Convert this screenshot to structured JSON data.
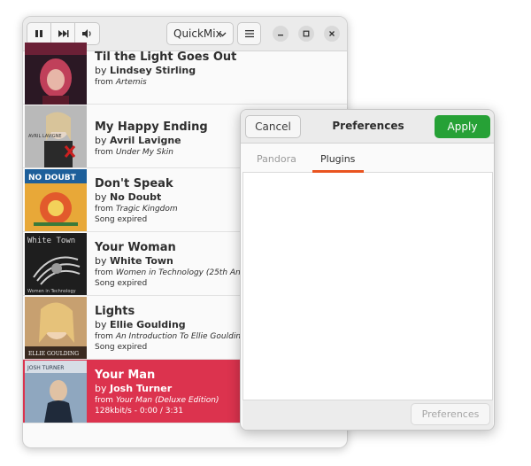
{
  "toolbar": {
    "play_pause_icon": "pause-icon",
    "next_icon": "skip-next-icon",
    "volume_icon": "volume-icon",
    "station_label": "QuickMix",
    "menu_icon": "hamburger-menu-icon"
  },
  "window_controls": [
    "minimize-icon",
    "maximize-icon",
    "close-icon"
  ],
  "songs": [
    {
      "title": "Til the Light Goes Out",
      "by_prefix": "by ",
      "artist": "Lindsey Stirling",
      "from_prefix": "from ",
      "album": "Artemis",
      "status": ""
    },
    {
      "title": "My Happy Ending",
      "by_prefix": "by ",
      "artist": "Avril Lavigne",
      "from_prefix": "from ",
      "album": "Under My Skin",
      "status": ""
    },
    {
      "title": "Don't Speak",
      "by_prefix": "by ",
      "artist": "No Doubt",
      "from_prefix": "from ",
      "album": "Tragic Kingdom",
      "status": "Song expired"
    },
    {
      "title": "Your Woman",
      "by_prefix": "by ",
      "artist": "White Town",
      "from_prefix": "from ",
      "album": "Women in Technology (25th Annive",
      "status": "Song expired",
      "art_text": "White Town",
      "art_caption": "Women in Technology"
    },
    {
      "title": "Lights",
      "by_prefix": "by ",
      "artist": "Ellie Goulding",
      "from_prefix": "from ",
      "album": "An Introduction To Ellie Goulding El",
      "status": "Song expired",
      "art_text": "ELLIE GOULDING"
    },
    {
      "title": "Your Man",
      "by_prefix": "by ",
      "artist": "Josh Turner",
      "from_prefix": "from ",
      "album": "Your Man (Deluxe Edition)",
      "status": "128kbit/s - 0:00 / 3:31",
      "art_text": "JOSH TURNER"
    }
  ],
  "album_art_labels": {
    "no_doubt": "NO DOUBT",
    "avril": "AVRIL LAVIGNE"
  },
  "dialog": {
    "cancel_label": "Cancel",
    "title": "Preferences",
    "apply_label": "Apply",
    "tabs": [
      {
        "label": "Pandora",
        "active": false
      },
      {
        "label": "Plugins",
        "active": true
      }
    ],
    "footer_button": "Preferences"
  },
  "colors": {
    "active_row": "#dc334e",
    "apply_button": "#26a136",
    "tab_underline": "#e95420"
  }
}
